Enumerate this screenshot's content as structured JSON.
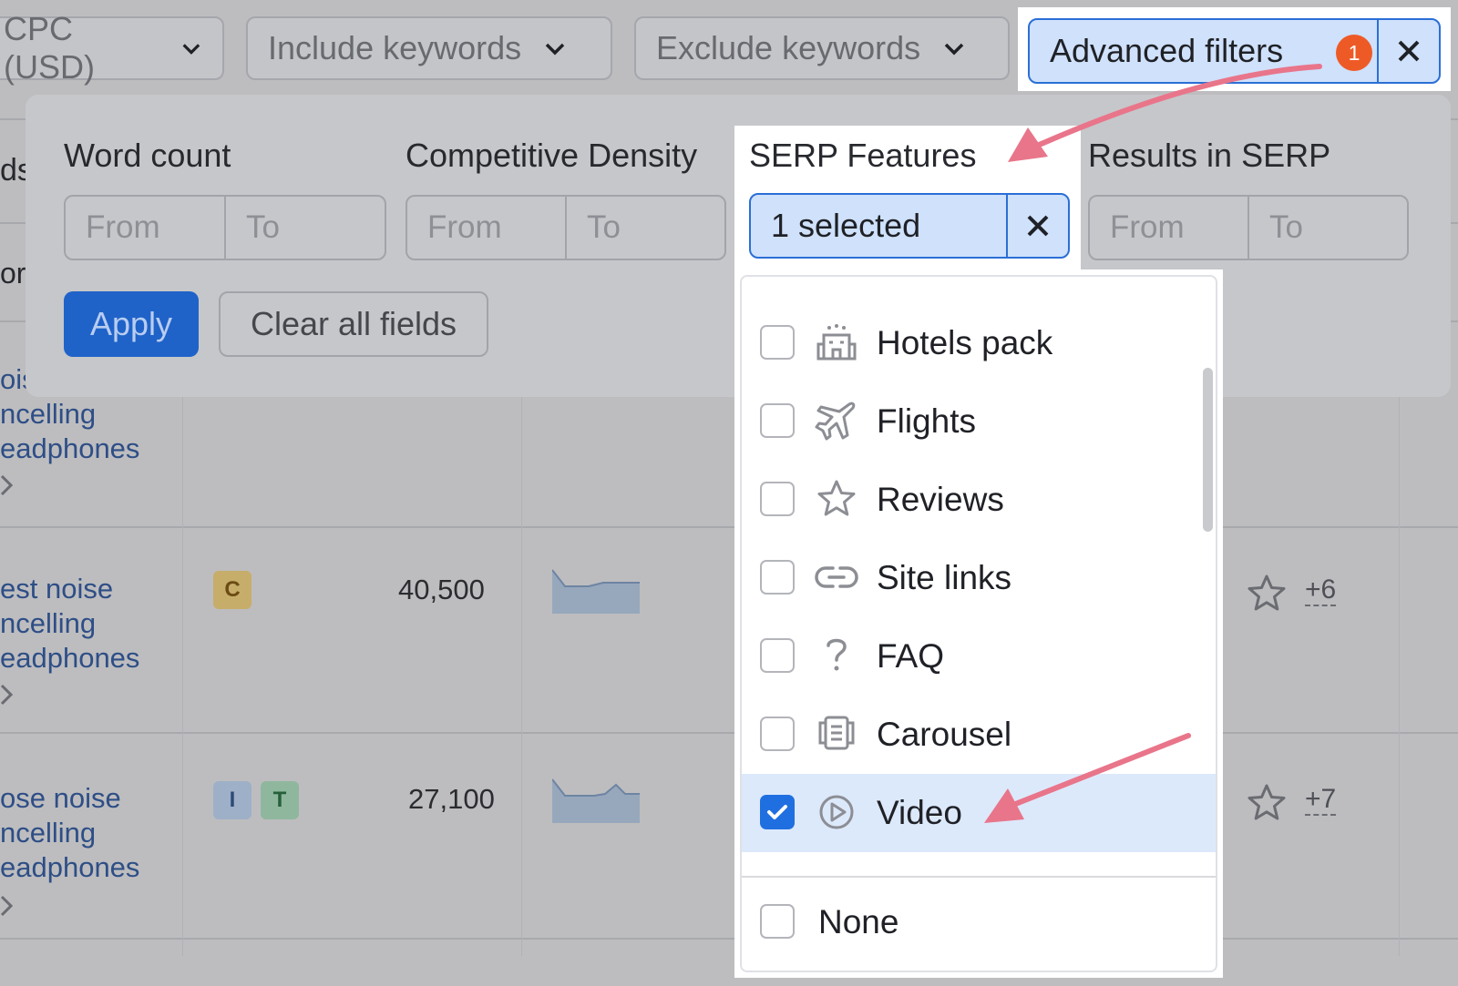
{
  "toolbar": {
    "cpc_label": "CPC (USD)",
    "include_label": "Include keywords",
    "exclude_label": "Exclude keywords",
    "advanced_label": "Advanced filters",
    "advanced_count": "1"
  },
  "filters": {
    "word_count": {
      "label": "Word count",
      "from": "From",
      "to": "To"
    },
    "competitive_density": {
      "label": "Competitive Density",
      "from": "From",
      "to": "To"
    },
    "serp_features": {
      "label": "SERP Features",
      "value": "1 selected"
    },
    "results_in_serp": {
      "label": "Results in SERP",
      "from": "From",
      "to": "To"
    },
    "apply_label": "Apply",
    "clear_label": "Clear all fields"
  },
  "serp_options": [
    {
      "label": "Hotels pack",
      "icon": "hotel-icon",
      "checked": false
    },
    {
      "label": "Flights",
      "icon": "plane-icon",
      "checked": false
    },
    {
      "label": "Reviews",
      "icon": "star-icon",
      "checked": false
    },
    {
      "label": "Site links",
      "icon": "link-icon",
      "checked": false
    },
    {
      "label": "FAQ",
      "icon": "question-icon",
      "checked": false
    },
    {
      "label": "Carousel",
      "icon": "carousel-icon",
      "checked": false
    },
    {
      "label": "Video",
      "icon": "play-icon",
      "checked": true
    },
    {
      "label": "None",
      "icon": "",
      "checked": false
    }
  ],
  "table": {
    "left_fragments": [
      "ds",
      "or"
    ],
    "rows": [
      {
        "keyword_lines": [
          "ois",
          "ncelling",
          "eadphones"
        ]
      },
      {
        "keyword_lines": [
          "est noise",
          "ncelling",
          "eadphones"
        ],
        "intents": [
          "C"
        ],
        "volume": "40,500",
        "more": "+6"
      },
      {
        "keyword_lines": [
          "ose noise",
          "ncelling",
          "eadphones"
        ],
        "intents": [
          "I",
          "T"
        ],
        "volume": "27,100",
        "more": "+7"
      }
    ]
  },
  "colors": {
    "accent": "#2b6fd6",
    "selected_bg": "#cfe1fb",
    "badge": "#ee5a26",
    "arrow": "#e9758a"
  }
}
